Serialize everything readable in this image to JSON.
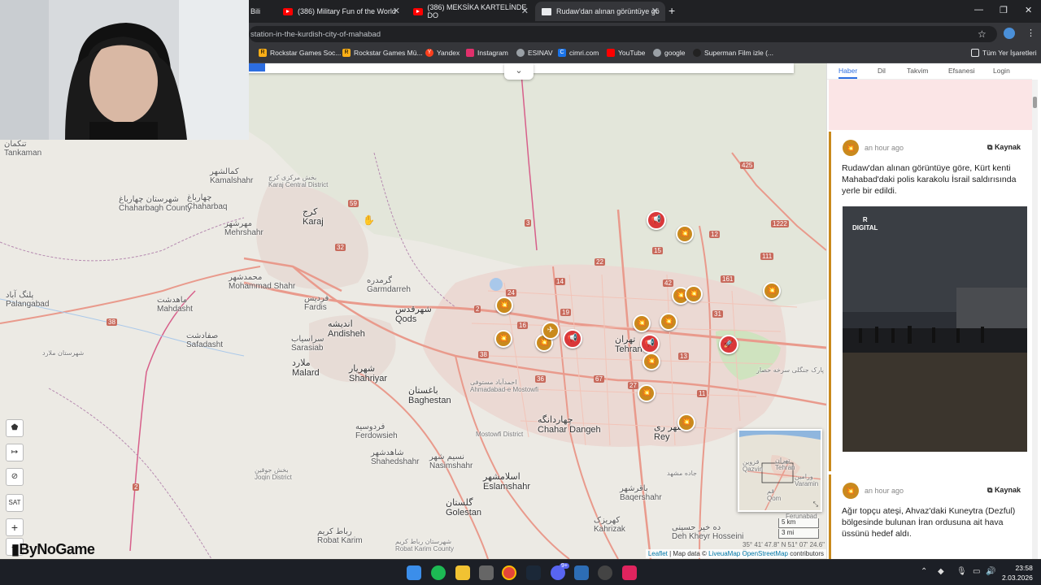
{
  "browser": {
    "tabs": [
      {
        "title": "Bili",
        "active": false
      },
      {
        "title": "(386) Military Fun of the World",
        "active": false
      },
      {
        "title": "(386) MEKSİKA KARTELİNDE DO",
        "active": false
      },
      {
        "title": "Rudaw'dan alınan görüntüye gö",
        "active": true
      }
    ],
    "close_glyph": "✕",
    "new_tab_glyph": "+",
    "url": "station-in-the-kurdish-city-of-mahabad",
    "bookmarks": [
      {
        "label": "Rockstar Games Soc...",
        "icon": "rockstar-icon",
        "color": "#fcaf17"
      },
      {
        "label": "Rockstar Games Mü...",
        "icon": "rockstar-icon",
        "color": "#fcaf17"
      },
      {
        "label": "Yandex",
        "icon": "yandex-icon",
        "color": "#fc3f1d"
      },
      {
        "label": "Instagram",
        "icon": "instagram-icon",
        "color": "#e1306c"
      },
      {
        "label": "ESINAV",
        "icon": "globe-icon",
        "color": "#9aa0a6"
      },
      {
        "label": "cimri.com",
        "icon": "cimri-icon",
        "color": "#1a73e8"
      },
      {
        "label": "YouTube",
        "icon": "youtube-icon",
        "color": "#ff0000"
      },
      {
        "label": "google",
        "icon": "globe-icon",
        "color": "#9aa0a6"
      },
      {
        "label": "Superman Film izle (...",
        "icon": "superman-icon",
        "color": "#9aa0a6"
      }
    ],
    "all_bookmarks": "Tüm Yer İşaretleri"
  },
  "map": {
    "labels": {
      "karaj": "Karaj",
      "karaj_fa": "کرج",
      "tehran": "Tehran",
      "tehran_fa": "تهران",
      "andisheh": "Andisheh",
      "andisheh_fa": "اندیشه",
      "qods": "Qods",
      "qods_fa": "شهرقدس",
      "shahriyar": "Shahriyar",
      "shahriyar_fa": "شهریار",
      "malard": "Malard",
      "malard_fa": "ملارد",
      "baghestan": "Baghestan",
      "baghestan_fa": "باغستان",
      "chahar_dangeh": "Chahar Dangeh",
      "chahar_dangeh_fa": "چهاردانگه",
      "eslamshahr": "Eslamshahr",
      "eslamshahr_fa": "اسلامشهر",
      "golestan": "Golestan",
      "golestan_fa": "گلستان",
      "rey": "Rey",
      "rey_fa": "شهر ری",
      "mehrshahr": "Mehrshahr",
      "mehrshahr_fa": "مهرشهر",
      "kamalshahr": "Kamalshahr",
      "kamalshahr_fa": "کمالشهر",
      "chaharbaq": "Chaharbaq",
      "chaharbaq_fa": "چهارباغ",
      "chaharbagh_county": "Chaharbagh County",
      "chaharbagh_county_fa": "شهرستان چهارباغ",
      "mahdasht": "Mahdasht",
      "mahdasht_fa": "ماهدشت",
      "mohammad_shahr": "Mohammad Shahr",
      "mohammad_shahr_fa": "محمدشهر",
      "safadasht": "Safadasht",
      "safadasht_fa": "صفادشت",
      "garmdarreh": "Garmdarreh",
      "garmdarreh_fa": "گرمدره",
      "fardis": "Fardis",
      "fardis_fa": "فردیس",
      "sarasiab": "Sarasiab",
      "sarasiab_fa": "سراسیاب",
      "ferdowsieh": "Ferdowsieh",
      "ferdowsieh_fa": "فردوسیه",
      "shahedshahr": "Shahedshahr",
      "shahedshahr_fa": "شاهدشهر",
      "nasimshahr": "Nasimshahr",
      "nasimshahr_fa": "نسیم شهر",
      "ahmadabad": "Ahmadabad-e Mostowfi",
      "ahmadabad_fa": "احمدآباد مستوفی",
      "baqershahr": "Baqershahr",
      "baqershahr_fa": "باقرشهر",
      "kahrizak": "Kahrizak",
      "kahrizak_fa": "کهریزک",
      "deh_kheyr": "Deh Kheyr Hosseini",
      "deh_kheyr_fa": "ده خیر حسینی",
      "robat_karim": "Robat Karim",
      "robat_karim_fa": "رباط کریم",
      "robat_karim_county": "Robat Karim County",
      "robat_karim_county_fa": "شهرستان رباط کریم",
      "tankaman": "Tankaman",
      "tankaman_fa": "تنکمان",
      "palangabad": "Palangabad",
      "palangabad_fa": "پلنگ آباد",
      "shahrestan_malard": "شهرستان ملارد",
      "karaj_central": "Karaj Central District",
      "karaj_central_fa": "بخش مرکزی کرج",
      "joqin": "Joqin District",
      "joqin_fa": "بخش جوقین",
      "park_jangali": "پارک جنگلی سرخه حصار",
      "mashhad_road": "جاده مشهد",
      "mostowfi_district": "Mostowfi District",
      "road_labels": [
        "3",
        "59",
        "32",
        "2",
        "24",
        "16",
        "19",
        "14",
        "22",
        "15",
        "12",
        "42",
        "161",
        "31",
        "1222",
        "111",
        "425",
        "13",
        "38",
        "36",
        "67",
        "27",
        "11",
        "2",
        "38"
      ],
      "minimap": {
        "tehran": "Tehran",
        "tehran_fa": "تهران",
        "qazvin": "Qazvin",
        "qazvin_fa": "قزوین",
        "varamin": "Varamin",
        "varamin_fa": "ورامین",
        "qom": "Qom",
        "qom_fa": "قم"
      },
      "feruzabad": "Ferunabad"
    },
    "controls": {
      "sat": "SAT",
      "zoom_in": "+",
      "zoom_out": "−",
      "collapse": "⌄"
    },
    "scale_km": "5 km",
    "scale_mi": "3 mi",
    "coords": "35° 41' 47.8\" N 51° 07' 24.6\" E",
    "attribution": {
      "leaflet": "Leaflet",
      "map_data": " | Map data © ",
      "liveuamap": "LiveuaMap",
      "osm": "OpenStreetMap",
      "contributors": " contributors"
    },
    "watermark": "ByNoGame"
  },
  "feed": {
    "nav": [
      "Haber",
      "Dil",
      "Takvim",
      "Efsanesi",
      "Login"
    ],
    "posts": [
      {
        "time": "an hour ago",
        "source": "Kaynak",
        "text": "Rudaw'dan alınan görüntüye göre, Kürt kenti Mahabad'daki polis karakolu İsrail saldırısında yerle bir edildi.",
        "image_badge": "DIGITAL",
        "image_logo": "R"
      },
      {
        "time": "an hour ago",
        "source": "Kaynak",
        "text": "Ağır topçu ateşi, Ahvaz'daki Kuneytra (Dezful) bölgesinde bulunan İran ordusuna ait hava üssünü hedef aldı."
      }
    ]
  },
  "taskbar": {
    "time": "23:58",
    "date": "2.03.2026",
    "badge": "9+"
  }
}
